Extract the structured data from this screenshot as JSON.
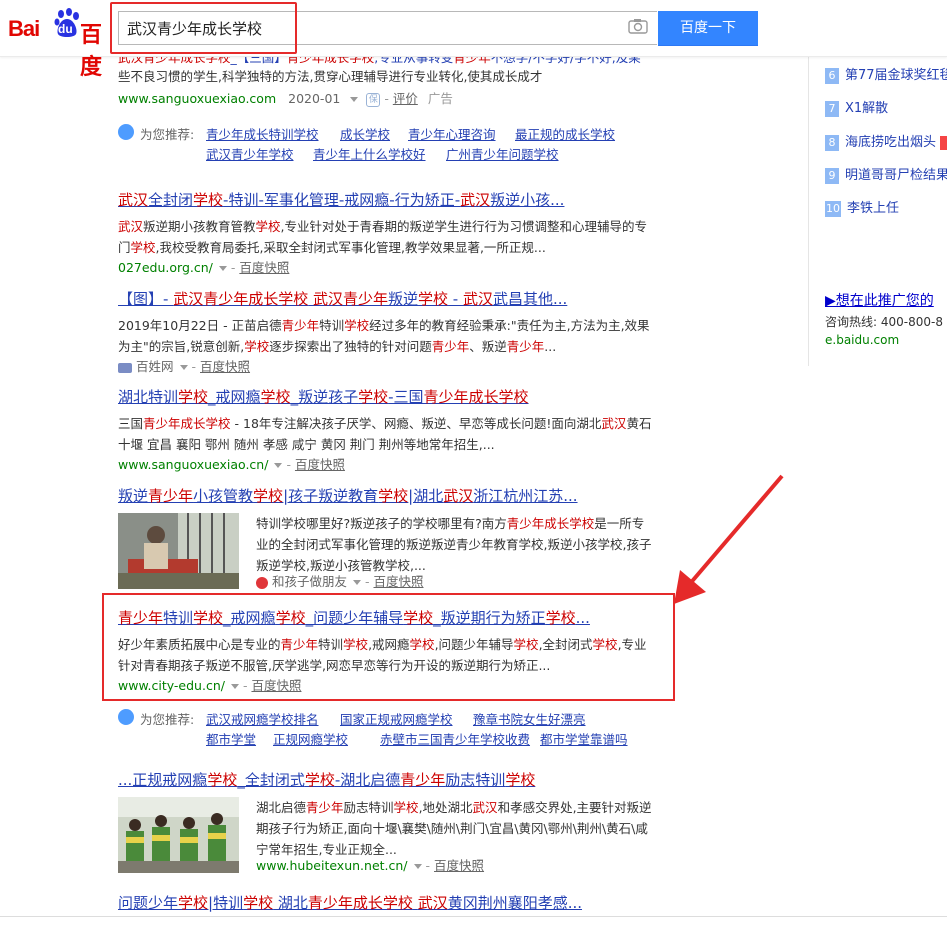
{
  "search": {
    "query": "武汉青少年成长学校",
    "button": "百度一下"
  },
  "logo": {
    "text_bai": "Bai",
    "text_du": "du",
    "text_cn": "百度"
  },
  "results": [
    {
      "title_html": "<span class='em'>武汉青少年成长学校</span>_【三国】<span class='em'>青少年成长学校</span>,专业从事转变<span class='em'>青少年</span>不想学/不学好/学不好,及某",
      "abstract": "些不良习惯的学生,科学独特的方法,贯穿心理辅导进行专业转化,使其成长成才",
      "url": "www.sanguoxuexiao.com",
      "date": "2020-01",
      "eval": "评价",
      "ad": "广告"
    },
    {
      "title_html": "<span class='em'>武汉</span>全封闭<span class='em'>学校</span>-特训-军事化管理-戒网瘾-行为矫正-<span class='em'>武汉</span>叛逆小孩...",
      "abstract_html": "<span class='em'>武汉</span>叛逆期小孩教育管教<span class='em'>学校</span>,专业针对处于青春期的叛逆学生进行行为习惯调整和心理辅导的专门<span class='em'>学校</span>,我校受教育局委托,采取全封闭式军事化管理,教学效果显著,一所正规...",
      "url": "027edu.org.cn/",
      "snapshot": "百度快照"
    },
    {
      "title_html": "【图】- <span class='em'>武汉青少年成长学校</span> <span class='em'>武汉青少年</span>叛逆<span class='em'>学校</span> - <span class='em'>武汉</span>武昌其他...",
      "abstract_html": "2019年10月22日 - 正苗启德<span class='em'>青少年</span>特训<span class='em'>学校</span>经过多年的教育经验秉承:\"责任为主,方法为主,效果为主\"的宗旨,锐意创新,<span class='em'>学校</span>逐步探索出了独特的针对问题<span class='em'>青少年</span>、叛逆<span class='em'>青少年</span>...",
      "url": "百姓网",
      "snapshot": "百度快照"
    },
    {
      "title_html": "湖北特训<span class='em'>学校</span>_戒网瘾<span class='em'>学校</span>_叛逆孩子<span class='em'>学校</span>-三国<span class='em'>青少年成长学校</span>",
      "abstract_html": "三国<span class='em'>青少年成长学校</span> - 18年专注解决孩子厌学、网瘾、叛逆、早恋等成长问题!面向湖北<span class='em'>武汉</span>黄石 十堰 宜昌 襄阳 鄂州 随州 孝感 咸宁 黄冈 荆门 荆州等地常年招生,...",
      "url": "www.sanguoxuexiao.cn/",
      "snapshot": "百度快照"
    },
    {
      "title_html": "叛逆<span class='em'>青少年</span>小孩管教<span class='em'>学校</span>|孩子叛逆教育<span class='em'>学校</span>|湖北<span class='em'>武汉</span>浙江杭州江苏...",
      "abstract_html": "特训学校哪里好?叛逆孩子的学校哪里有?南方<span class='em'>青少年成长学校</span>是一所专业的全封闭式军事化管理的叛逆叛逆青少年教育学校,叛逆小孩学校,孩子叛逆学校,叛逆小孩管教学校,...",
      "url": "和孩子做朋友",
      "snapshot": "百度快照"
    },
    {
      "title_html": "<span class='em'>青少年</span>特训<span class='em'>学校</span>_戒网瘾<span class='em'>学校</span>_问题少年辅导<span class='em'>学校</span>_叛逆期行为矫正<span class='em'>学校</span>...",
      "abstract_html": "好少年素质拓展中心是专业的<span class='em'>青少年</span>特训<span class='em'>学校</span>,戒网瘾<span class='em'>学校</span>,问题少年辅导<span class='em'>学校</span>,全封闭式<span class='em'>学校</span>,专业针对青春期孩子叛逆不服管,厌学逃学,网恋早恋等行为开设的叛逆期行为矫正...",
      "url": "www.city-edu.cn/",
      "snapshot": "百度快照"
    },
    {
      "title_html": "...正规戒网瘾<span class='em'>学校</span>_全封闭式<span class='em'>学校</span>-湖北启德<span class='em'>青少年</span>励志特训<span class='em'>学校</span>",
      "abstract_html": "湖北启德<span class='em'>青少年</span>励志特训<span class='em'>学校</span>,地处湖北<span class='em'>武汉</span>和孝感交界处,主要针对叛逆期孩子行为矫正,面向十堰\\襄樊\\随州\\荆门\\宜昌\\黄冈\\鄂州\\荆州\\黄石\\咸宁常年招生,专业正规全...",
      "url": "www.hubeitexun.net.cn/",
      "snapshot": "百度快照"
    },
    {
      "title_html": "问题少年<span class='em'>学校</span>|特训<span class='em'>学校</span> 湖北<span class='em'>青少年成长学校</span> <span class='em'>武汉</span>黄冈荆州襄阳孝感..."
    }
  ],
  "recommend1": {
    "label": "为您推荐:",
    "items": [
      "青少年成长特训学校",
      "成长学校",
      "青少年心理咨询",
      "最正规的成长学校",
      "武汉青少年学校",
      "青少年上什么学校好",
      "广州青少年问题学校"
    ]
  },
  "recommend2": {
    "label": "为您推荐:",
    "items": [
      "武汉戒网瘾学校排名",
      "国家正规戒网瘾学校",
      "豫章书院女生好漂亮",
      "都市学堂",
      "正规网瘾学校",
      "赤壁市三国青少年学校收费",
      "都市学堂靠谱吗"
    ]
  },
  "hot": [
    {
      "num": "6",
      "text": "第77届金球奖红毯"
    },
    {
      "num": "7",
      "text": "X1解散"
    },
    {
      "num": "8",
      "text": "海底捞吃出烟头"
    },
    {
      "num": "9",
      "text": "明道哥哥尸检结果"
    },
    {
      "num": "10",
      "text": "李铁上任"
    }
  ],
  "promo": {
    "title": "▶想在此推广您的",
    "tel": "咨询热线: 400-800-8",
    "url": "e.baidu.com"
  },
  "colors": {
    "accent": "#3385ff",
    "title": "#2440b3",
    "highlight": "#c00",
    "url": "#008000",
    "annotation": "#e52a2a"
  }
}
